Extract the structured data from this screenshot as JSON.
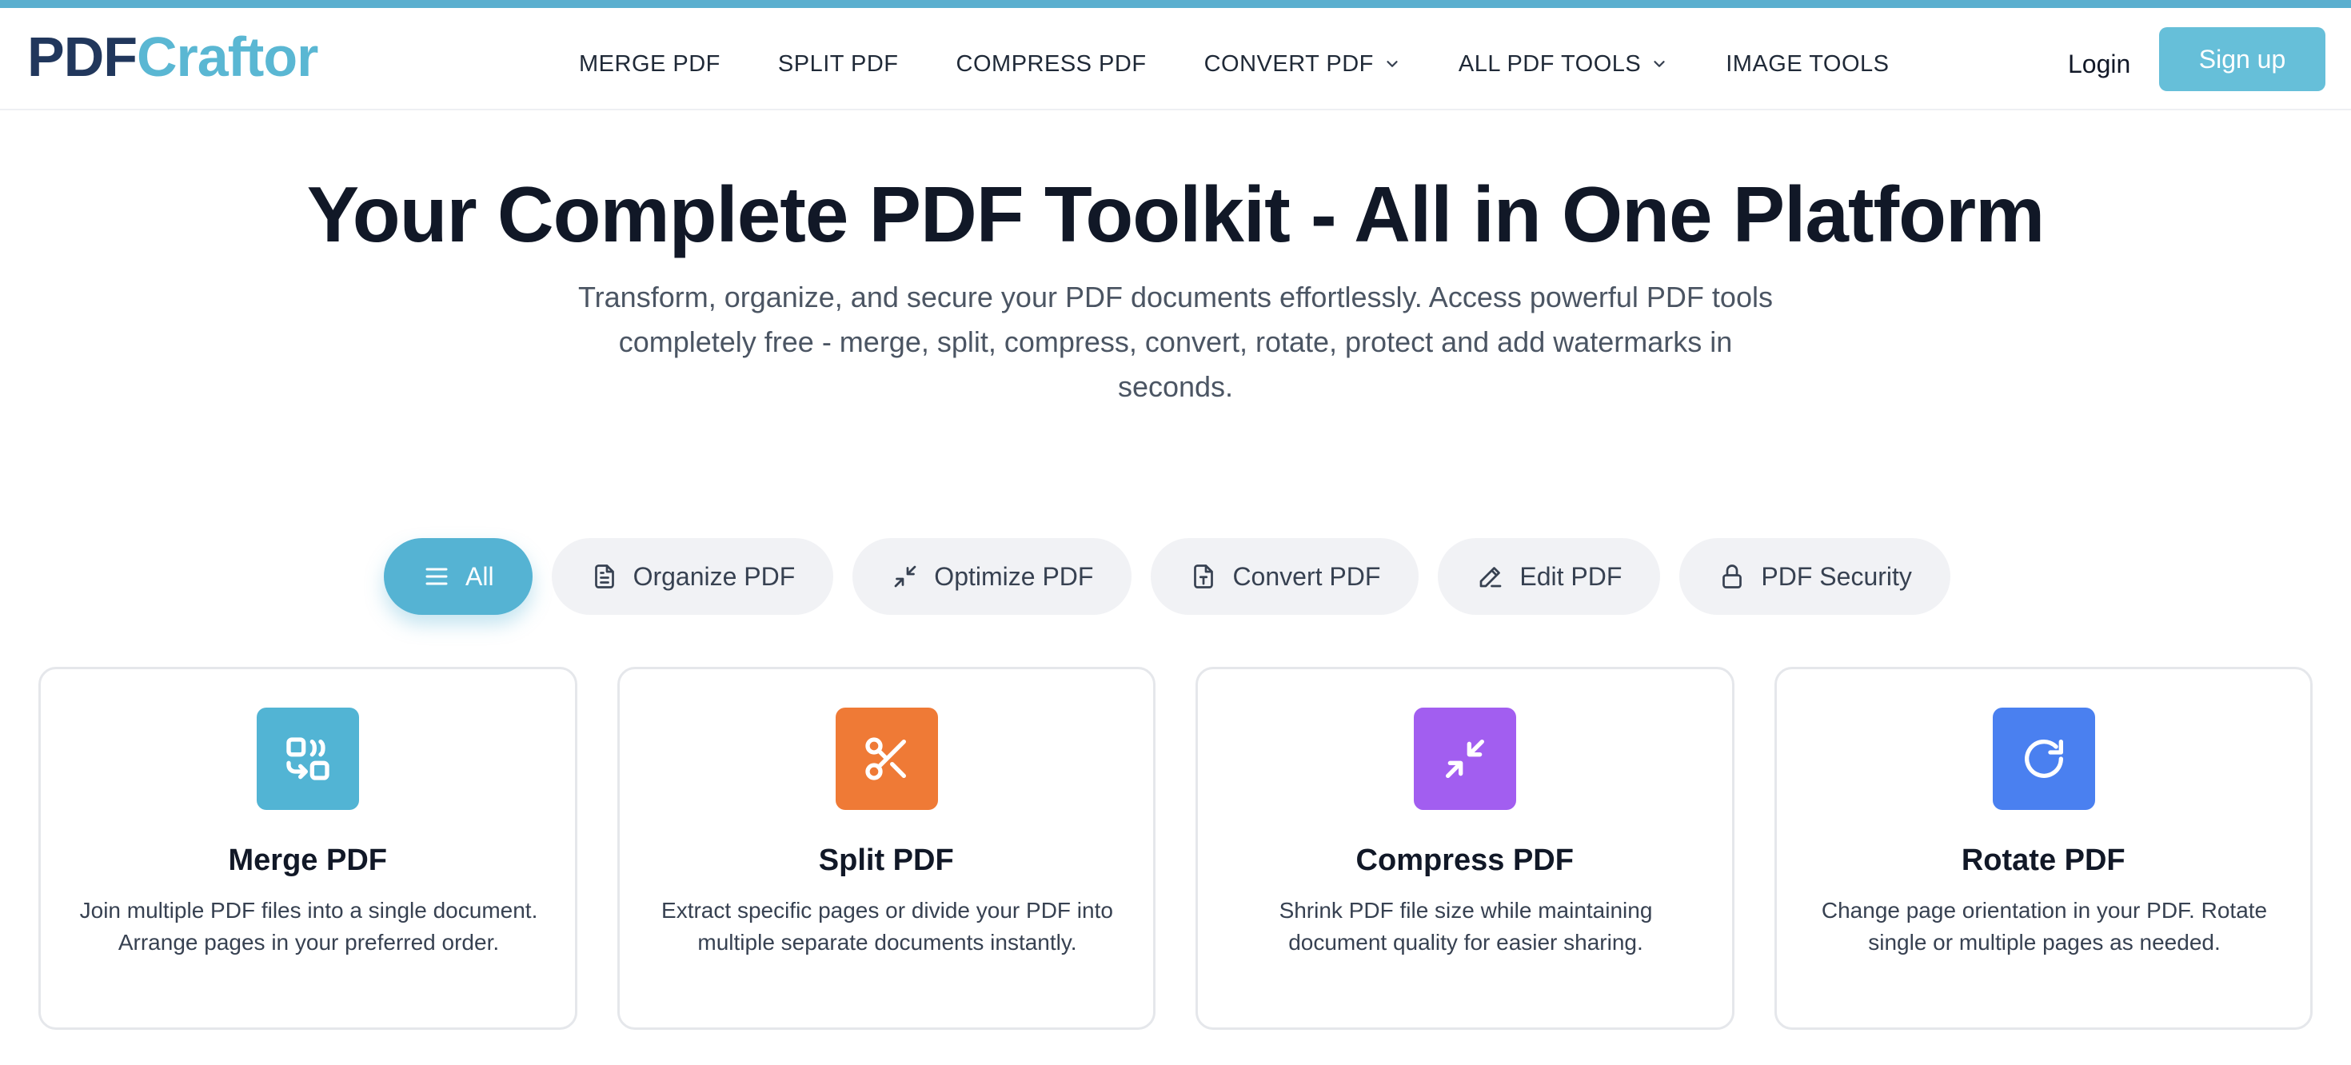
{
  "brand": {
    "part1": "PDF",
    "part2": "Craftor"
  },
  "nav": {
    "items": [
      {
        "label": "MERGE PDF"
      },
      {
        "label": "SPLIT PDF"
      },
      {
        "label": "COMPRESS PDF"
      },
      {
        "label": "CONVERT PDF"
      },
      {
        "label": "ALL PDF TOOLS"
      },
      {
        "label": "IMAGE TOOLS"
      }
    ],
    "login": "Login",
    "signup": "Sign up"
  },
  "hero": {
    "title": "Your Complete PDF Toolkit - All in One Platform",
    "subtitle": "Transform, organize, and secure your PDF documents effortlessly. Access powerful PDF tools completely free - merge, split, compress, convert, rotate, protect and add watermarks in seconds."
  },
  "filters": [
    {
      "label": "All",
      "icon": "menu-icon",
      "active": true
    },
    {
      "label": "Organize PDF",
      "icon": "document-icon"
    },
    {
      "label": "Optimize PDF",
      "icon": "minimize-arrows-icon"
    },
    {
      "label": "Convert PDF",
      "icon": "file-text-icon"
    },
    {
      "label": "Edit PDF",
      "icon": "pencil-icon"
    },
    {
      "label": "PDF Security",
      "icon": "lock-icon"
    }
  ],
  "tools": [
    {
      "title": "Merge PDF",
      "desc": "Join multiple PDF files into a single document. Arrange pages in your preferred order.",
      "icon": "merge-icon",
      "color": "#52b4d4"
    },
    {
      "title": "Split PDF",
      "desc": "Extract specific pages or divide your PDF into multiple separate documents instantly.",
      "icon": "scissors-icon",
      "color": "#ef7a36"
    },
    {
      "title": "Compress PDF",
      "desc": "Shrink PDF file size while maintaining document quality for easier sharing.",
      "icon": "compress-icon",
      "color": "#a25ef0"
    },
    {
      "title": "Rotate PDF",
      "desc": "Change page orientation in your PDF. Rotate single or multiple pages as needed.",
      "icon": "rotate-icon",
      "color": "#4a80f0"
    }
  ]
}
